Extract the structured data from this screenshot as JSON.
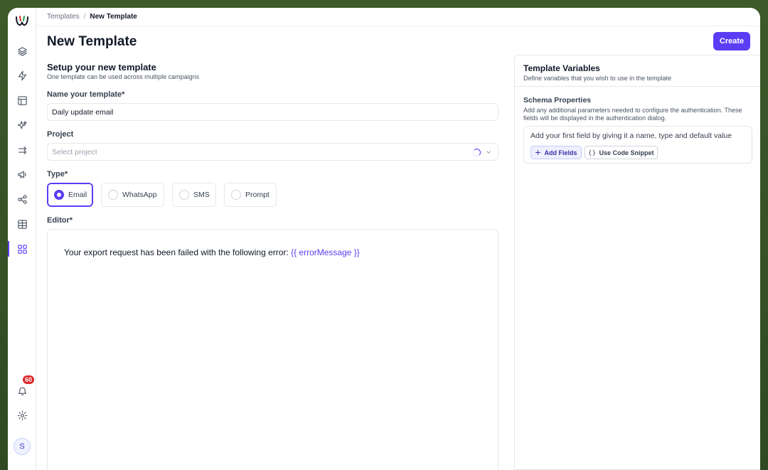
{
  "breadcrumb": {
    "root": "Templates",
    "separator": "/",
    "current": "New Template"
  },
  "page": {
    "title": "New Template",
    "create_label": "Create"
  },
  "setup": {
    "title": "Setup your new template",
    "subtitle": "One template can be used across multiple campaigns"
  },
  "name_field": {
    "label": "Name your template*",
    "value": "Daily update email"
  },
  "project_field": {
    "label": "Project",
    "placeholder": "Select project"
  },
  "type": {
    "label": "Type*",
    "options": [
      {
        "label": "Email",
        "selected": true
      },
      {
        "label": "WhatsApp",
        "selected": false
      },
      {
        "label": "SMS",
        "selected": false
      },
      {
        "label": "Prompt",
        "selected": false
      }
    ]
  },
  "editor": {
    "label": "Editor*",
    "text": "Your export request has been failed with the following error: ",
    "variable": "{{ errorMessage }}"
  },
  "variables_panel": {
    "title": "Template Variables",
    "subtitle": "Define variables that you wish to use in the template",
    "schema_title": "Schema Properties",
    "schema_desc": "Add any additional parameters needed to configure the authentication. These fields will be displayed in the authentication dialog.",
    "fields_hint": "Add your first field by giving it a name, type and default value",
    "add_fields_label": "Add Fields",
    "code_snippet_label": "Use Code Snippet"
  },
  "sidebar": {
    "items": [
      "layers-icon",
      "bolt-icon",
      "layout-icon",
      "sparkles-icon",
      "arrows-icon",
      "megaphone-icon",
      "share-icon",
      "table-icon",
      "grid-icon"
    ],
    "active": "grid-icon",
    "notifications_count": "60",
    "avatar_initial": "S"
  },
  "colors": {
    "accent": "#5b3df5",
    "badge": "#dc2626"
  }
}
